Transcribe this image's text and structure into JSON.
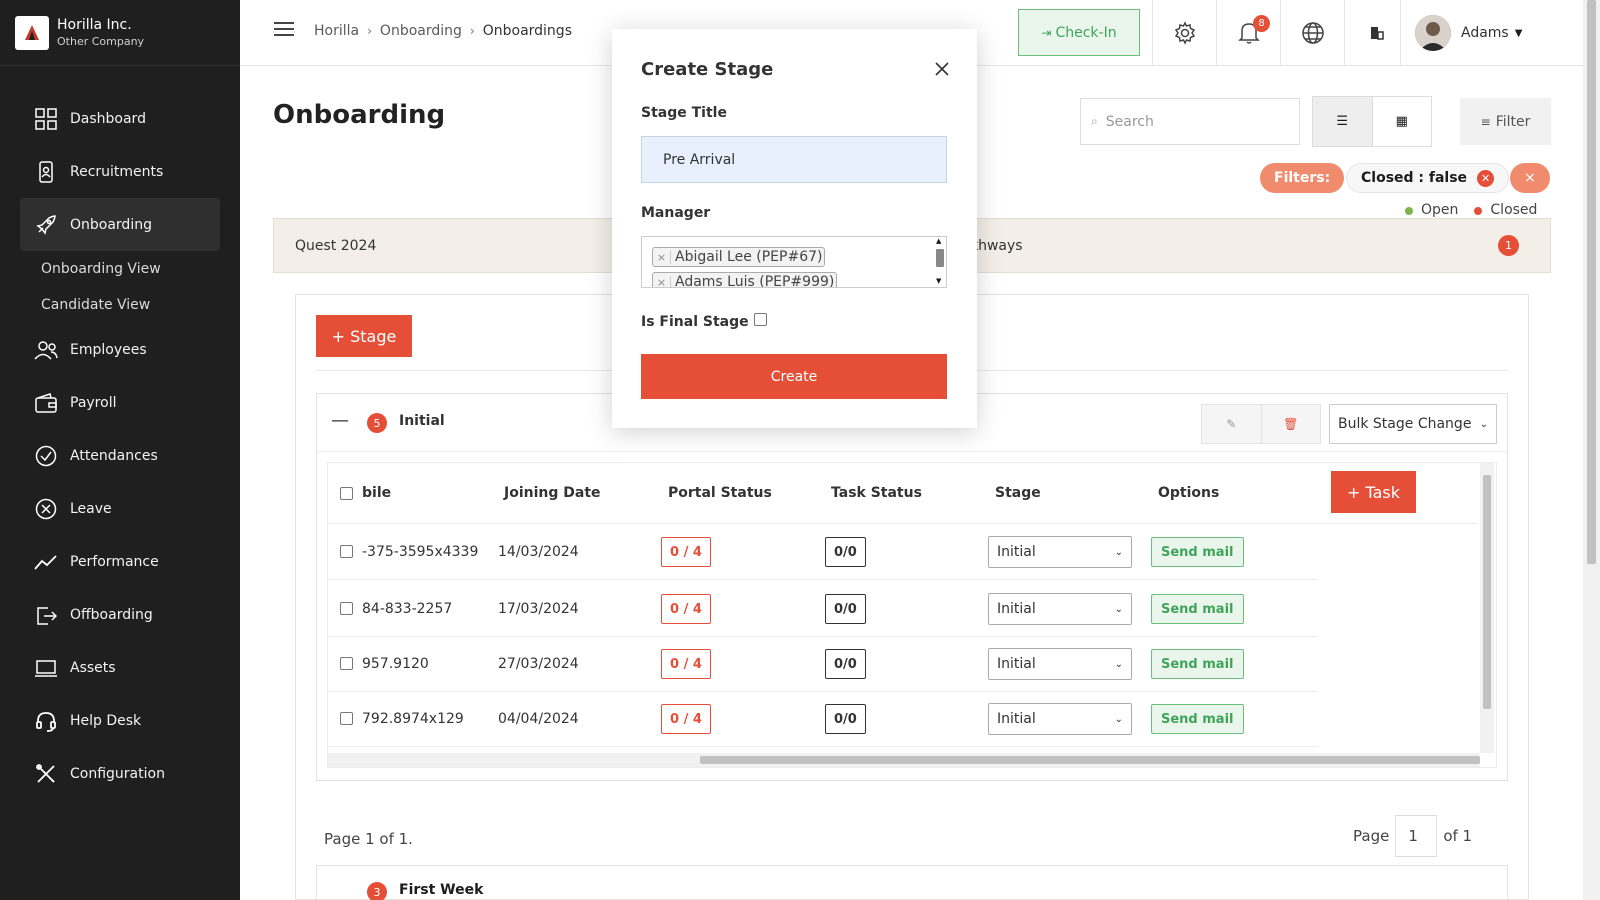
{
  "company": {
    "name": "Horilla Inc.",
    "subtitle": "Other Company"
  },
  "sidebar": {
    "items": [
      {
        "label": "Dashboard",
        "icon": "dashboard-icon"
      },
      {
        "label": "Recruitments",
        "icon": "recruitment-icon"
      },
      {
        "label": "Onboarding",
        "icon": "rocket-icon",
        "active": true
      },
      {
        "label": "Employees",
        "icon": "employees-icon"
      },
      {
        "label": "Payroll",
        "icon": "wallet-icon"
      },
      {
        "label": "Attendances",
        "icon": "check-circle-icon"
      },
      {
        "label": "Leave",
        "icon": "x-circle-icon"
      },
      {
        "label": "Performance",
        "icon": "trend-icon"
      },
      {
        "label": "Offboarding",
        "icon": "exit-icon"
      },
      {
        "label": "Assets",
        "icon": "laptop-icon"
      },
      {
        "label": "Help Desk",
        "icon": "headset-icon"
      },
      {
        "label": "Configuration",
        "icon": "tools-icon"
      }
    ],
    "onboarding_sub": [
      "Onboarding View",
      "Candidate View"
    ]
  },
  "topbar": {
    "breadcrumbs": [
      "Horilla",
      "Onboarding",
      "Onboardings"
    ],
    "checkin_label": "Check-In",
    "notification_count": "8",
    "user_name": "Adams"
  },
  "main": {
    "title": "Onboarding",
    "search_placeholder": "Search",
    "filter_label": "Filter",
    "filters_label": "Filters:",
    "active_filter": "Closed : false",
    "clear_label": "×",
    "legend": [
      {
        "label": "Open",
        "color": "#7ab648"
      },
      {
        "label": "Closed",
        "color": "#e54f38"
      }
    ],
    "pipeline_tabs": [
      {
        "label": "Quest 2024"
      },
      {
        "label": "athways"
      }
    ],
    "pipeline_badge": "1",
    "stage_button": "+ Stage",
    "stage": {
      "name": "Initial",
      "count": "5",
      "bulk_label": "Bulk Stage Change",
      "task_button": "+ Task",
      "columns": [
        "bile",
        "Joining Date",
        "Portal Status",
        "Task Status",
        "Stage",
        "Options"
      ],
      "rows": [
        {
          "mobile": "-375-3595x4339",
          "joining": "14/03/2024",
          "portal": "0 / 4",
          "task": "0/0",
          "stage": "Initial",
          "action": "Send mail"
        },
        {
          "mobile": "84-833-2257",
          "joining": "17/03/2024",
          "portal": "0 / 4",
          "task": "0/0",
          "stage": "Initial",
          "action": "Send mail"
        },
        {
          "mobile": "957.9120",
          "joining": "27/03/2024",
          "portal": "0 / 4",
          "task": "0/0",
          "stage": "Initial",
          "action": "Send mail"
        },
        {
          "mobile": "792.8974x129",
          "joining": "04/04/2024",
          "portal": "0 / 4",
          "task": "0/0",
          "stage": "Initial",
          "action": "Send mail"
        }
      ]
    },
    "pagination": {
      "info": "Page 1 of 1.",
      "page_label": "Page",
      "page_value": "1",
      "of_label": "of 1"
    },
    "next_stage": {
      "name": "First Week",
      "count": "3"
    }
  },
  "modal": {
    "title": "Create Stage",
    "stage_title_label": "Stage Title",
    "stage_title_value": "Pre Arrival",
    "manager_label": "Manager",
    "managers": [
      "Abigail Lee (PEP#67)",
      "Adams Luis (PEP#999)"
    ],
    "final_stage_label": "Is Final Stage",
    "create_label": "Create"
  },
  "colors": {
    "accent": "#e54f38",
    "success": "#3fa45a",
    "sidebar": "#1f1f1f"
  }
}
